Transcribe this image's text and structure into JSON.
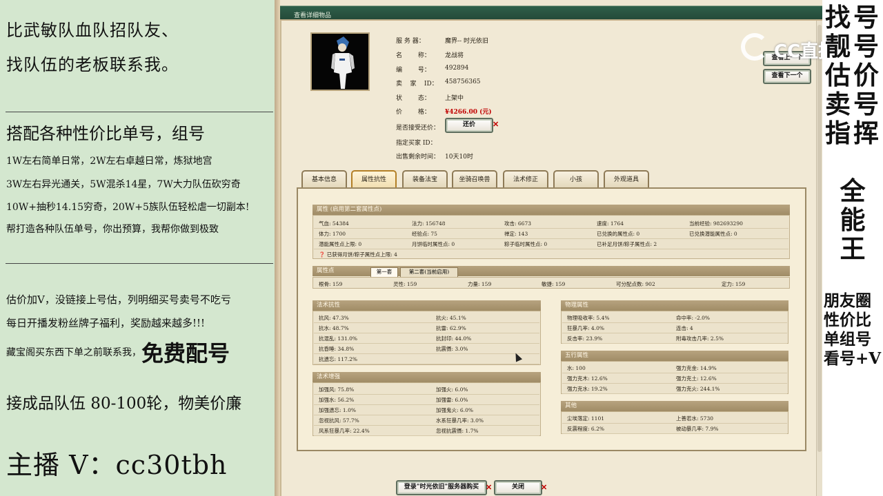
{
  "left_panel": {
    "line1": "比武敏队血队招队友、",
    "line2": "找队伍的老板联系我。",
    "heading2": "搭配各种性价比单号，组号",
    "detail1": "1W左右简单日常，2W左右卓越日常，炼狱地宫",
    "detail2": "3W左右异光通关，5W混杀14星，7W大力队伍砍穷奇",
    "detail3": "10W+抽秒14.15穷奇，20W+5族队伍轻松虐一切副本!",
    "detail4": "帮打造各种队伍单号，你出预算，我帮你做到极致",
    "detail5": "估价加V，没链接上号估，列明细买号卖号不吃亏",
    "detail6": "每日开播发粉丝牌子福利，奖励越来越多!!!",
    "detail7_prefix": "藏宝阁买东西下单之前联系我，",
    "detail7_big": "免费配号",
    "detail8": "接成品队伍 80-100轮，物美价廉",
    "contact": "主播 V：cc30tbh"
  },
  "window": {
    "title": "查看详细物品",
    "fields": [
      {
        "label": "服 务 器：",
        "value": "魔界-- 时光依旧"
      },
      {
        "label": "名        称：",
        "value": "龙战将"
      },
      {
        "label": "编        号：",
        "value": "492894"
      },
      {
        "label": "卖    家    ID：",
        "value": "458756365"
      },
      {
        "label": "状        态：",
        "value": "上架中"
      },
      {
        "label": "价        格：",
        "value": "¥4266.00 (元)"
      },
      {
        "label": "是否接受还价：",
        "value": ""
      },
      {
        "label": "指定买家 ID：",
        "value": ""
      },
      {
        "label": "出售剩余时间：",
        "value": "10天10时"
      }
    ],
    "bargain_button": "还价",
    "view_prev": "查看上一个",
    "view_next": "查看下一个",
    "tabs": [
      "基本信息",
      "属性抗性",
      "装备法宝",
      "坐骑召唤兽",
      "法术修正",
      "小孩",
      "外观道具"
    ],
    "active_tab": "属性抗性",
    "attr_section": {
      "title": "属性 (启用第二套属性点)",
      "rows": [
        [
          "气血: 54384",
          "法力: 156748",
          "攻击: 6673",
          "速度: 1764",
          "当前经验: 982693290"
        ],
        [
          "体力: 1700",
          "经验点: 75",
          "禅定: 143",
          "已兑换的属性点: 0",
          "已兑换潜能属性点: 0"
        ],
        [
          "潜能属性点上限: 0",
          "月饼临时属性点: 0",
          "粽子临时属性点: 0",
          "已补足月饼/粽子属性点: 2",
          ""
        ]
      ],
      "footnote": "已获得月饼/粽子属性点上限: 4"
    },
    "points_section": {
      "title": "属性点",
      "subtabs": [
        "第一套",
        "第二套(当前启用)"
      ],
      "row": [
        "根骨: 159",
        "灵性: 159",
        "力量: 159",
        "敏捷: 159",
        "可分配点数: 902",
        "定力: 159"
      ]
    },
    "magic_resist": {
      "title": "法术抗性",
      "rows": [
        [
          "抗风: 47.3%",
          "抗火: 45.1%"
        ],
        [
          "抗水: 48.7%",
          "抗雷: 62.9%"
        ],
        [
          "抗混乱: 131.0%",
          "抗封印: 44.0%"
        ],
        [
          "抗昏睡: 34.8%",
          "抗震慑: 3.0%"
        ],
        [
          "抗遗忘: 117.2%",
          ""
        ]
      ]
    },
    "magic_boost": {
      "title": "法术增强",
      "rows": [
        [
          "加强风: 75.8%",
          "加强火: 6.0%"
        ],
        [
          "加强水: 56.2%",
          "加强雷: 6.0%"
        ],
        [
          "加强遗忘: 1.0%",
          "加强鬼火: 6.0%"
        ],
        [
          "忽视抗风: 57.7%",
          "水系狂暴几率: 3.0%"
        ],
        [
          "风系狂暴几率: 22.4%",
          "忽视抗震慑: 1.7%"
        ]
      ]
    },
    "physical": {
      "title": "物理属性",
      "rows": [
        [
          "物理吸收率: 5.4%",
          "命中率: -2.0%"
        ],
        [
          "狂暴几率: 4.0%",
          "连击: 4"
        ],
        [
          "反击率: 23.9%",
          "附毒攻击几率: 2.5%"
        ]
      ]
    },
    "five_elements": {
      "title": "五行属性",
      "rows": [
        [
          "水: 100",
          "强力克金: 14.9%"
        ],
        [
          "强力克木: 12.6%",
          "强力克土: 12.6%"
        ],
        [
          "强力克水: 19.2%",
          "强力克火: 244.1%"
        ]
      ]
    },
    "other": {
      "title": "其他",
      "rows": [
        [
          "尘埃落定: 1101",
          "上善若水: 5730"
        ],
        [
          "反震程度: 6.2%",
          "被动暴几率: 7.9%"
        ]
      ]
    },
    "buy_button": "登录\"时光依旧\"服务器购买",
    "close_button": "关闭"
  },
  "right_strip": {
    "col1": [
      "找",
      "靓",
      "估",
      "卖",
      "指"
    ],
    "col2": [
      "号",
      "号",
      "价",
      "号",
      "挥"
    ],
    "center": [
      "全",
      "能",
      "王"
    ],
    "bottom": [
      "朋友圈",
      "性价比",
      "单组号",
      "看号+V"
    ]
  },
  "logo": {
    "text": "CC直播"
  }
}
